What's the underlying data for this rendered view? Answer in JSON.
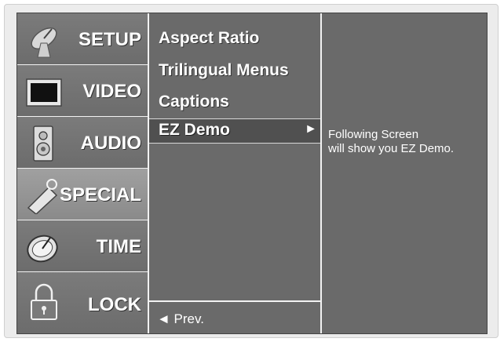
{
  "sidebar": {
    "items": [
      {
        "label": "SETUP",
        "icon": "satellite-dish-icon"
      },
      {
        "label": "VIDEO",
        "icon": "tv-screen-icon"
      },
      {
        "label": "AUDIO",
        "icon": "speaker-icon"
      },
      {
        "label": "SPECIAL",
        "icon": "tag-icon",
        "active": true
      },
      {
        "label": "TIME",
        "icon": "clock-icon"
      },
      {
        "label": "LOCK",
        "icon": "padlock-icon"
      }
    ]
  },
  "menu": {
    "items": [
      "Aspect Ratio",
      "Trilingual Menus",
      "Captions"
    ],
    "selected": {
      "label": "EZ Demo",
      "arrow": "►"
    },
    "prev": "◄ Prev."
  },
  "description": {
    "line1": "Following Screen",
    "line2": "will show you EZ Demo."
  },
  "colors": {
    "panel": "#6a6a6a",
    "selected_bar": "#505050",
    "text": "#ffffff"
  }
}
